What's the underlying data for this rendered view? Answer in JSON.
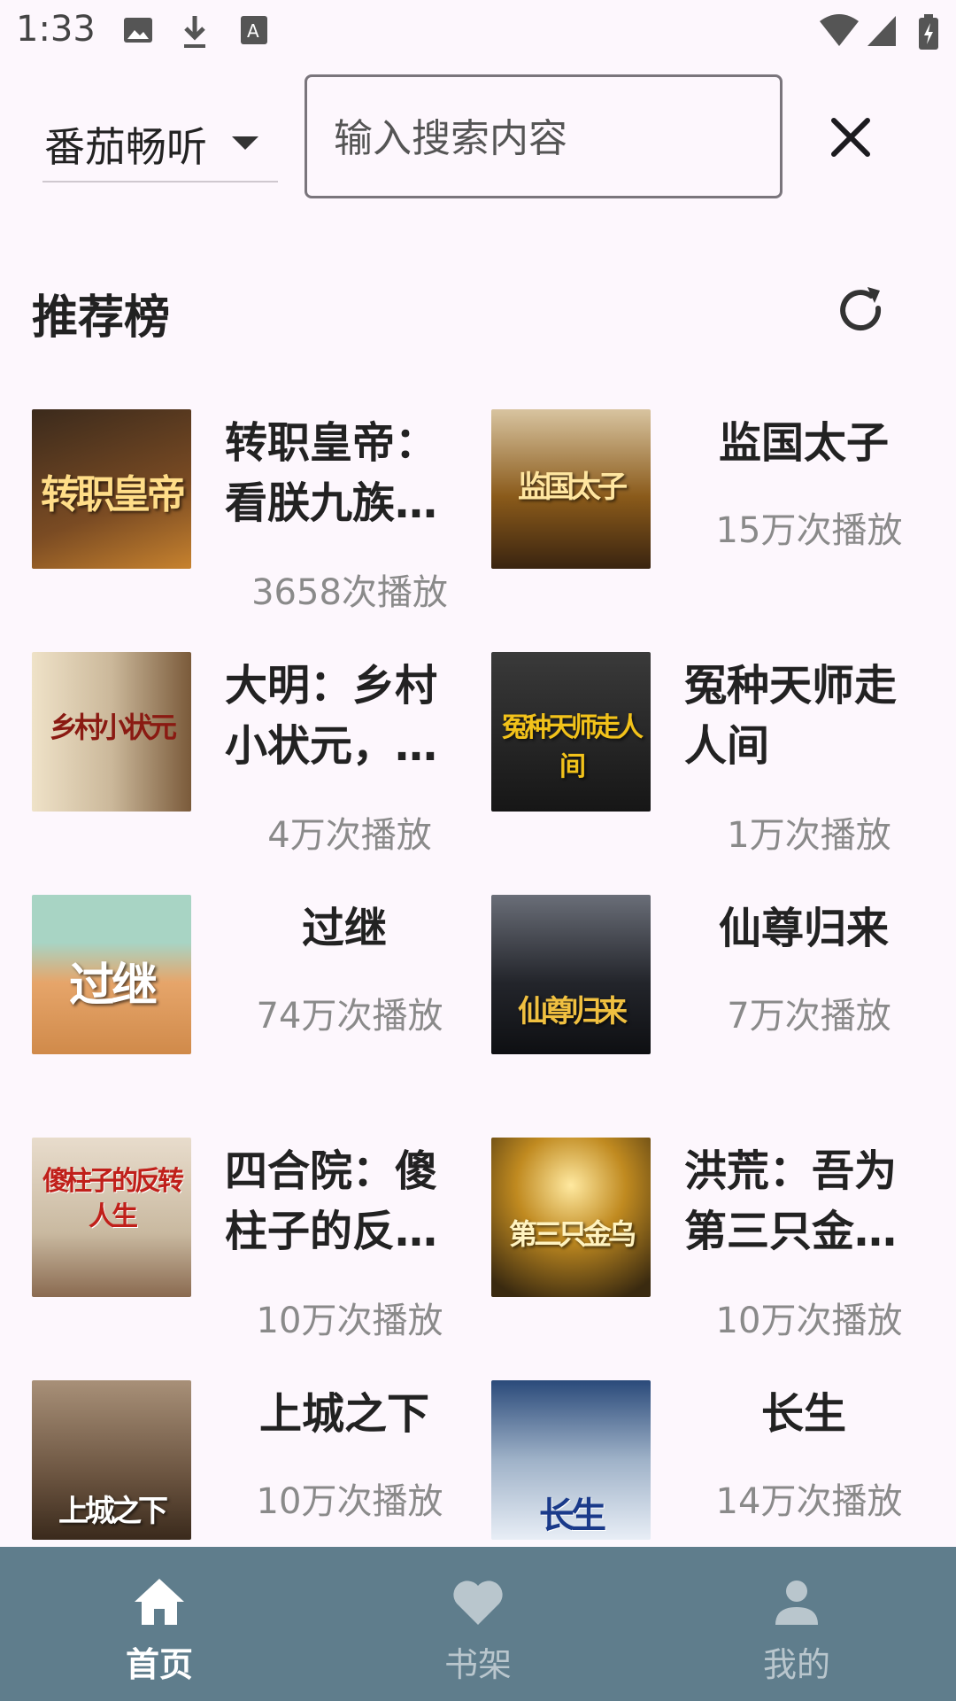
{
  "status_bar": {
    "time": "1:33"
  },
  "search_bar": {
    "source": "番茄畅听",
    "placeholder": "输入搜索内容"
  },
  "section": {
    "title": "推荐榜"
  },
  "books": [
    {
      "title": "转职皇帝：看朕九族…",
      "plays": "3658次播放",
      "cover_text": "转职皇帝",
      "cover_color": "#5a3a22"
    },
    {
      "title": "监国太子",
      "plays": "15万次播放",
      "cover_text": "监国太子",
      "cover_color": "#8a5a1a"
    },
    {
      "title": "大明：乡村小状元，…",
      "plays": "4万次播放",
      "cover_text": "乡村小状元",
      "cover_color": "#cbb89a"
    },
    {
      "title": "冤种天师走人间",
      "plays": "1万次播放",
      "cover_text": "冤种天师走人间",
      "cover_color": "#2a2a2a"
    },
    {
      "title": "过继",
      "plays": "74万次播放",
      "cover_text": "过继",
      "cover_color": "#d9a36b"
    },
    {
      "title": "仙尊归来",
      "plays": "7万次播放",
      "cover_text": "仙尊归来",
      "cover_color": "#23252b"
    },
    {
      "title": "四合院：傻柱子的反…",
      "plays": "10万次播放",
      "cover_text": "傻柱子的反转人生",
      "cover_color": "#c9b9a0"
    },
    {
      "title": "洪荒：吾为第三只金…",
      "plays": "10万次播放",
      "cover_text": "第三只金乌",
      "cover_color": "#5a4418"
    },
    {
      "title": "上城之下",
      "plays": "10万次播放",
      "cover_text": "上城之下",
      "cover_color": "#6b5440"
    },
    {
      "title": "长生",
      "plays": "14万次播放",
      "cover_text": "长生",
      "cover_color": "#9fb2c8"
    }
  ],
  "bottom_nav": [
    {
      "label": "首页",
      "icon": "home-icon",
      "active": true
    },
    {
      "label": "书架",
      "icon": "heart-icon",
      "active": false
    },
    {
      "label": "我的",
      "icon": "person-icon",
      "active": false
    }
  ]
}
